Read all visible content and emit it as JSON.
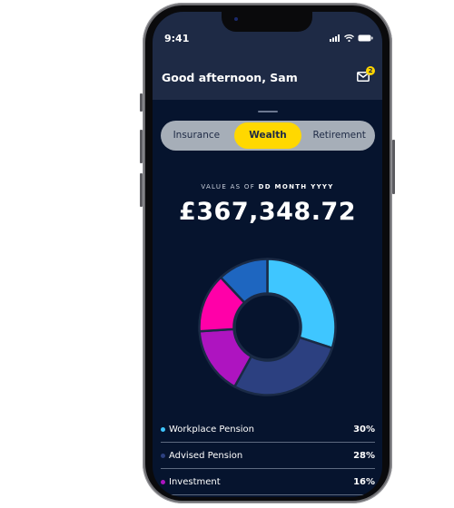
{
  "status_bar": {
    "time": "9:41"
  },
  "header": {
    "greeting": "Good afternoon, Sam",
    "inbox_badge_count": "2"
  },
  "tabs": [
    {
      "label": "Insurance",
      "active": false
    },
    {
      "label": "Wealth",
      "active": true
    },
    {
      "label": "Retirement",
      "active": false
    }
  ],
  "summary": {
    "value_label_prefix": "VALUE AS OF",
    "value_label_date": "DD MONTH YYYY",
    "amount": "£367,348.72"
  },
  "colors": {
    "header_bg": "#1e2a45",
    "screen_bg": "#06142e",
    "accent_yellow": "#ffd800"
  },
  "chart_data": {
    "type": "pie",
    "title": "",
    "series": [
      {
        "name": "Workplace Pension",
        "value": 30,
        "color": "#3fc6ff"
      },
      {
        "name": "Advised Pension",
        "value": 28,
        "color": "#2c4080"
      },
      {
        "name": "Investment",
        "value": 16,
        "color": "#ae14c0"
      },
      {
        "name": "Unlabeled segment (pink)",
        "value": 14,
        "color": "#ff00a8"
      },
      {
        "name": "Unlabeled segment (blue)",
        "value": 12,
        "color": "#1e66c0"
      }
    ]
  },
  "legend": [
    {
      "name": "Workplace Pension",
      "pct": "30%",
      "color": "#3fc6ff"
    },
    {
      "name": "Advised Pension",
      "pct": "28%",
      "color": "#2c4080"
    },
    {
      "name": "Investment",
      "pct": "16%",
      "color": "#ae14c0"
    }
  ]
}
